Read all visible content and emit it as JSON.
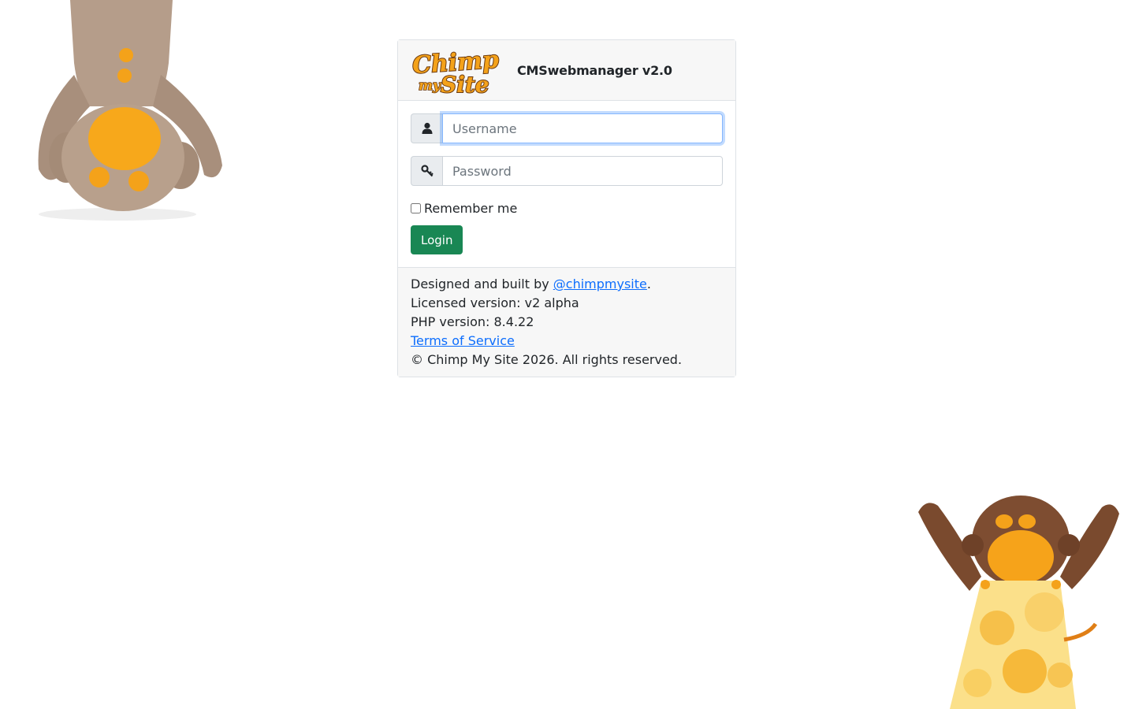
{
  "header": {
    "logo_alt": "Chimp my Site",
    "app_title": "CMSwebmanager v2.0"
  },
  "form": {
    "username_placeholder": "Username",
    "username_value": "",
    "password_placeholder": "Password",
    "password_value": "",
    "remember_label": "Remember me",
    "remember_checked": false,
    "login_label": "Login"
  },
  "footer": {
    "designed_prefix": "Designed and built by ",
    "designed_link": "@chimpmysite",
    "designed_suffix": ".",
    "licensed": "Licensed version: v2 alpha",
    "php": "PHP version: 8.4.22",
    "terms_link": "Terms of Service",
    "copyright": "© Chimp My Site 2026. All rights reserved."
  },
  "icons": {
    "username": "user-icon",
    "password": "key-icon"
  },
  "colors": {
    "login_button": "#198754",
    "link": "#0d6efd",
    "logo_orange": "#f4a21a",
    "logo_brown": "#6b3a12"
  }
}
